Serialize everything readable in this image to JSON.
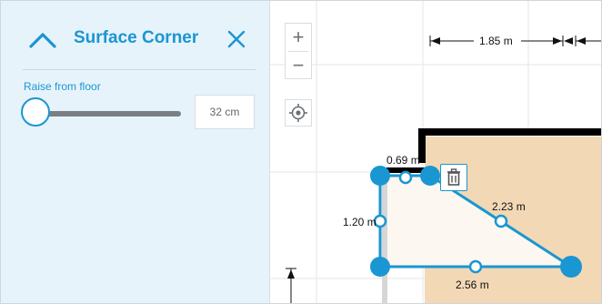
{
  "panel": {
    "title": "Surface Corner",
    "icon": "corner-icon",
    "close_icon": "close-icon",
    "slider": {
      "label": "Raise from floor",
      "value_text": "32 cm",
      "level": 0
    }
  },
  "canvas": {
    "zoom_in_label": "+",
    "zoom_out_label": "−",
    "locate_icon": "locate-icon",
    "delete_icon": "trash-icon",
    "dimensions": {
      "top": "1.85 m",
      "top_left": "0.69 m",
      "left": "1.20 m",
      "diagonal": "2.23 m",
      "bottom": "2.56 m"
    }
  },
  "colors": {
    "accent": "#1a96d2",
    "panel_bg": "#e7f3fb",
    "room_fill": "#f3d8b5",
    "selected_fill": "#fdf7f1",
    "wall": "#000000"
  }
}
